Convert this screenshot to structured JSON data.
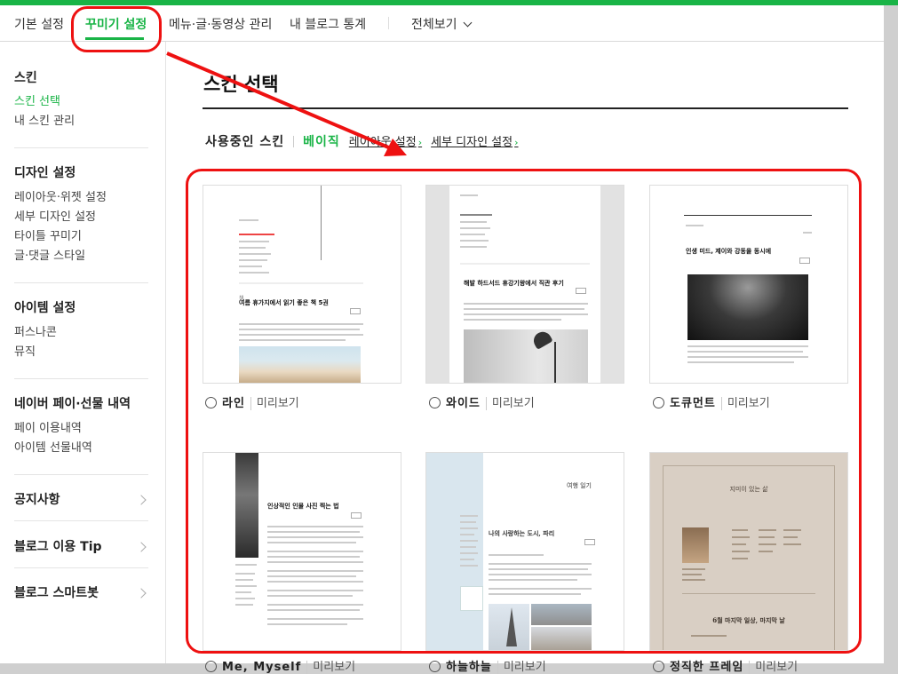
{
  "gnb": {
    "items": [
      "기본 설정",
      "꾸미기 설정",
      "메뉴·글·동영상 관리",
      "내 블로그 통계"
    ],
    "more": "전체보기"
  },
  "sidebar": {
    "skin_title": "스킨",
    "skin_items": [
      "스킨 선택",
      "내 스킨 관리"
    ],
    "design_title": "디자인 설정",
    "design_items": [
      "레이아웃·위젯 설정",
      "세부 디자인 설정",
      "타이틀 꾸미기",
      "글·댓글 스타일"
    ],
    "item_title": "아이템 설정",
    "item_items": [
      "퍼스나콘",
      "뮤직"
    ],
    "pay_title": "네이버 페이·선물 내역",
    "pay_items": [
      "페이 이용내역",
      "아이템 선물내역"
    ],
    "links": [
      "공지사항",
      "블로그 이용 Tip",
      "블로그 스마트봇"
    ]
  },
  "main": {
    "title": "스킨 선택",
    "using_label": "사용중인 스킨",
    "current_skin": "베이직",
    "layout_link": "레이아웃 설정",
    "detail_link": "세부 디자인 설정",
    "preview_label": "미리보기",
    "skins": [
      {
        "name": "라인",
        "post_title": "여름 휴가지에서 읽기 좋은 책 5권"
      },
      {
        "name": "와이드",
        "post_title": "해발 하드서드 휴강기왕에서 직관 후기"
      },
      {
        "name": "도큐먼트",
        "post_title": "인생 미드, 제이와 강동을 동시에"
      },
      {
        "name": "Me, Myself",
        "post_title": "인상적인 인물 사진 찍는 법"
      },
      {
        "name": "하늘하늘",
        "post_title": "나의 사랑하는 도시, 파리",
        "header": "여행 일기"
      },
      {
        "name": "정직한 프레임",
        "post_title": "6월 마지막 일상, 마지막 날",
        "header": "지미이 있는 삶"
      }
    ]
  },
  "colors": {
    "accent": "#19b446",
    "annotation": "#e11111"
  }
}
